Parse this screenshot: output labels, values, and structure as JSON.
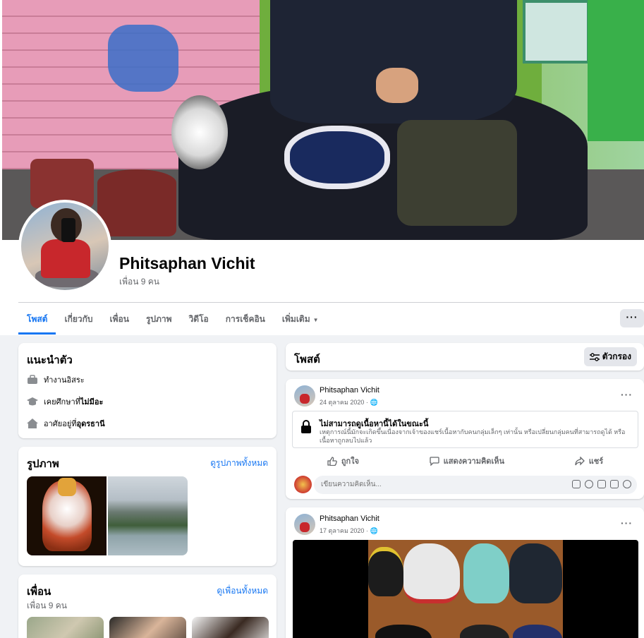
{
  "profile": {
    "name": "Phitsaphan Vichit",
    "friends_count": "เพื่อน 9 คน"
  },
  "tabs": [
    {
      "label": "โพสต์",
      "active": true
    },
    {
      "label": "เกี่ยวกับ"
    },
    {
      "label": "เพื่อน"
    },
    {
      "label": "รูปภาพ"
    },
    {
      "label": "วิดีโอ"
    },
    {
      "label": "การเช็คอิน"
    },
    {
      "label": "เพิ่มเติม"
    }
  ],
  "more_button": "···",
  "intro": {
    "title": "แนะนำตัว",
    "items": [
      {
        "icon": "briefcase-icon",
        "text": "ทำงานอิสระ"
      },
      {
        "icon": "graduation-cap-icon",
        "prefix": "เคยศึกษาที่ ",
        "value": "ไม่มีอะ"
      },
      {
        "icon": "home-icon",
        "prefix": "อาศัยอยู่ที่ ",
        "value": "อุดรธานี"
      }
    ]
  },
  "photos": {
    "title": "รูปภาพ",
    "see_all": "ดูรูปภาพทั้งหมด"
  },
  "friends": {
    "title": "เพื่อน",
    "see_all": "ดูเพื่อนทั้งหมด",
    "subtitle": "เพื่อน 9 คน"
  },
  "posts_header": {
    "title": "โพสต์",
    "filter_label": "ตัวกรอง"
  },
  "posts": [
    {
      "author": "Phitsaphan Vichit",
      "date": "24 ตุลาคม 2020 ·",
      "unavailable_title": "ไม่สามารถดูเนื้อหานี้ได้ในขณะนี้",
      "unavailable_text": "เหตุการณ์นี้มักจะเกิดขึ้นเนื่องจากเจ้าของแชร์เนื้อหากับคนกลุ่มเล็กๆ เท่านั้น หรือเปลี่ยนกลุ่มคนที่สามารถดูได้ หรือเนื้อหาถูกลบไปแล้ว",
      "actions": {
        "like": "ถูกใจ",
        "comment": "แสดงความคิดเห็น",
        "share": "แชร์"
      },
      "comment_placeholder": "เขียนความคิดเห็น..."
    },
    {
      "author": "Phitsaphan Vichit",
      "date": "17 ตุลาคม 2020 ·"
    }
  ],
  "colors": {
    "accent": "#1877f2",
    "background": "#f0f2f5",
    "secondary_text": "#65676b"
  }
}
